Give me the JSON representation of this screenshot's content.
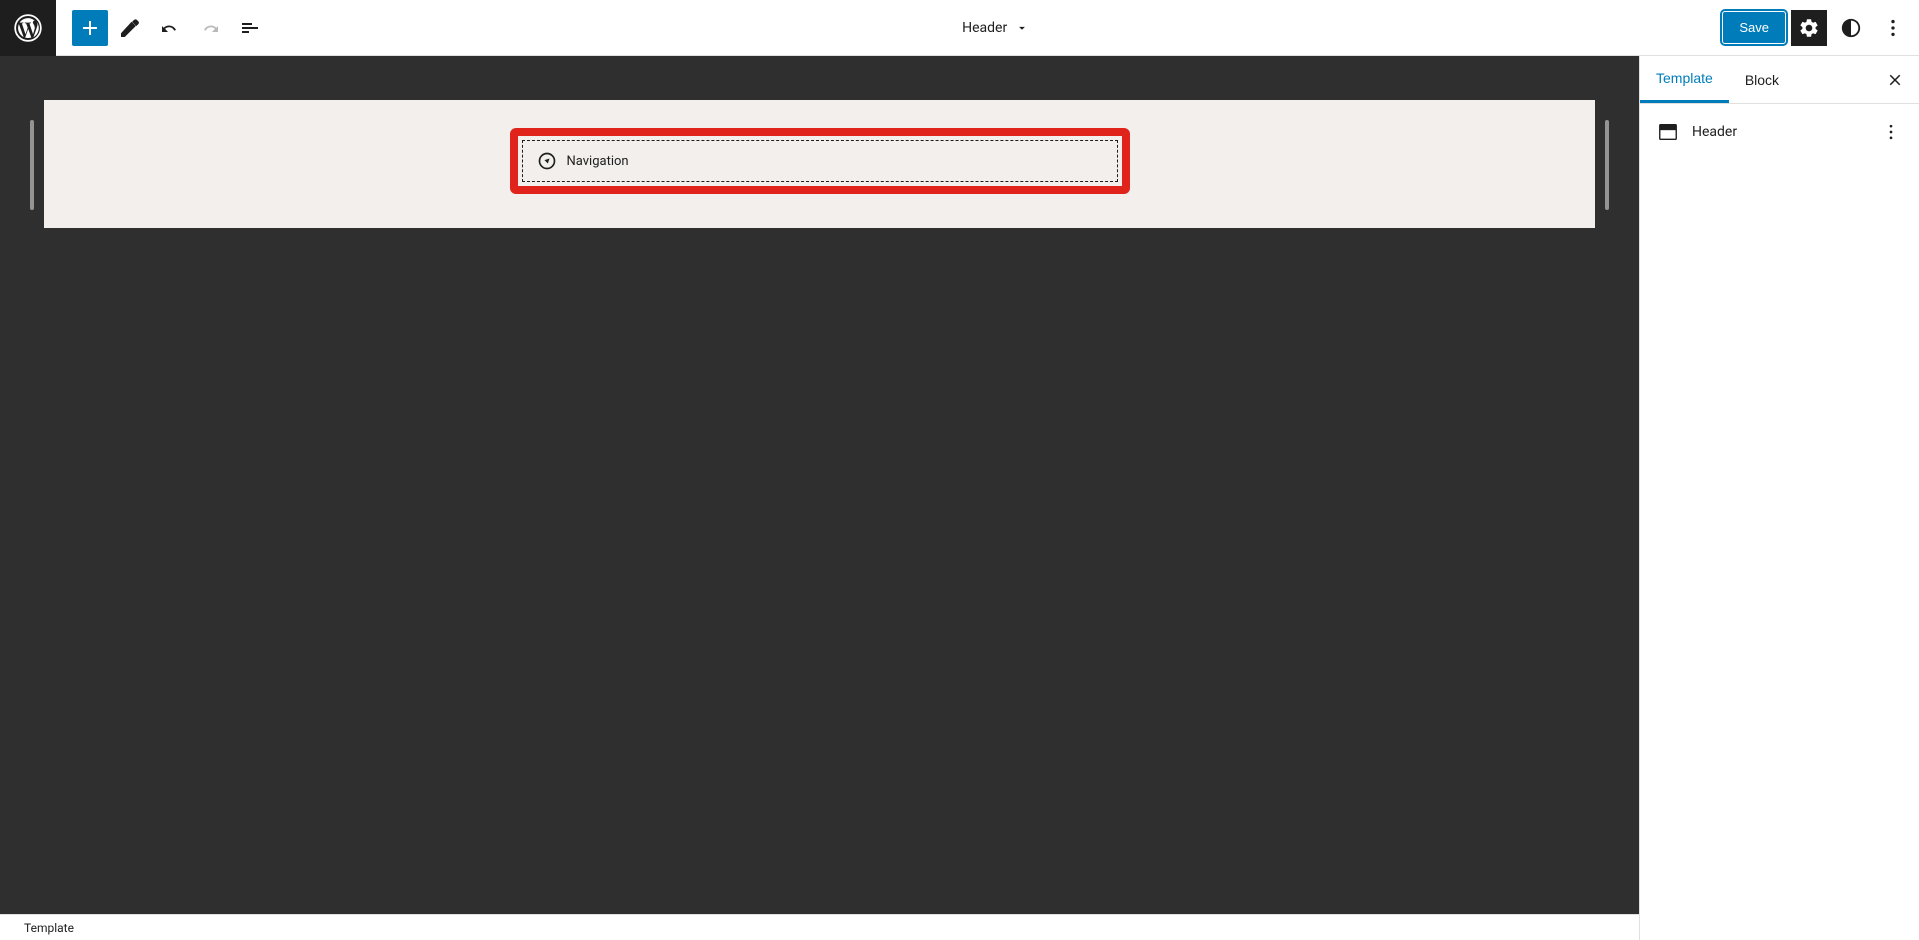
{
  "toolbar": {
    "template_name": "Header",
    "save_label": "Save"
  },
  "canvas": {
    "block_label": "Navigation"
  },
  "sidebar": {
    "tabs": {
      "template": "Template",
      "block": "Block"
    },
    "template_name": "Header"
  },
  "footer": {
    "breadcrumb": "Template"
  }
}
